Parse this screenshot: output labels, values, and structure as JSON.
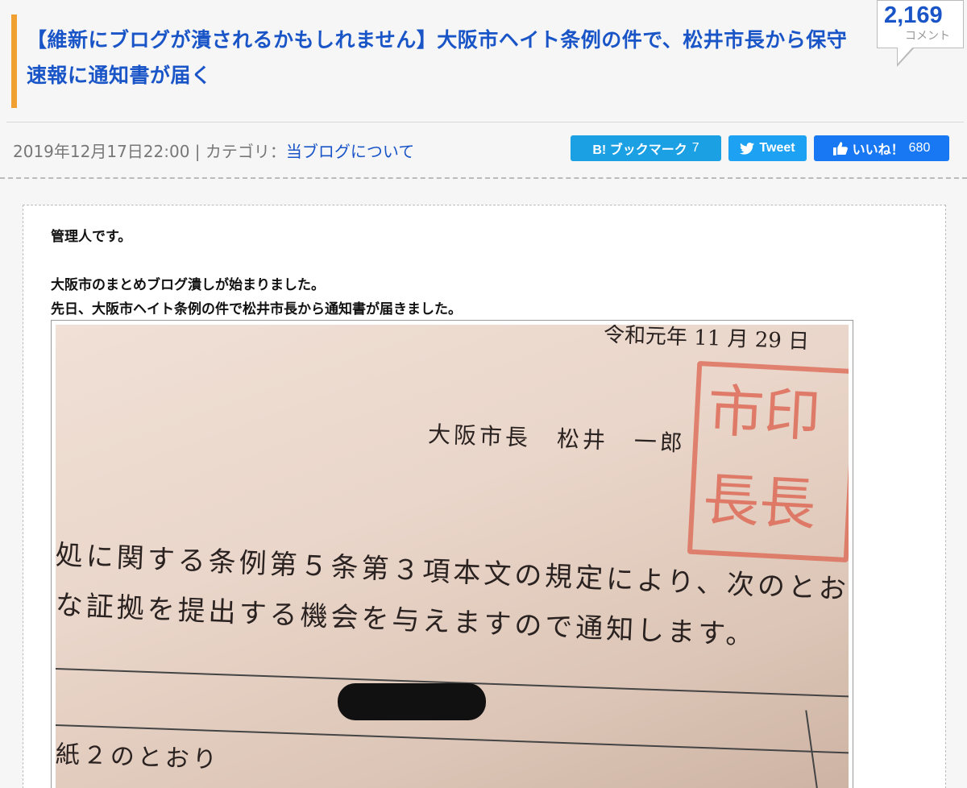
{
  "post": {
    "title": "【維新にブログが潰されるかもしれません】大阪市ヘイト条例の件で、松井市長から保守速報に通知書が届く",
    "comments": {
      "count": "2,169",
      "label": "コメント"
    },
    "meta": {
      "datetime": "2019年12月17日22:00",
      "separator": "|",
      "category_prefix": "カテゴリ：",
      "category": "当ブログについて"
    },
    "share": {
      "hatena": {
        "label": "B! ブックマーク",
        "count": "7"
      },
      "tweet": {
        "label": "Tweet"
      },
      "like": {
        "label": "いいね！",
        "count": "680"
      }
    },
    "colors": {
      "title": "#1a55c8",
      "accent_bar": "#f0a030"
    }
  },
  "body": {
    "p1": "管理人です。",
    "p2": "大阪市のまとめブログ潰しが始まりました。",
    "p3": "先日、大阪市ヘイト条例の件で松井市長から通知書が届きました。"
  },
  "letter": {
    "date": "令和元年 11 月 29 日",
    "mayor": "大阪市長　松井　一郎",
    "line1": "処に関する条例第５条第３項本文の規定により、次のとお",
    "line2": "な証拠を提出する機会を与えますので通知します。",
    "line3": "紙２のとおり"
  }
}
